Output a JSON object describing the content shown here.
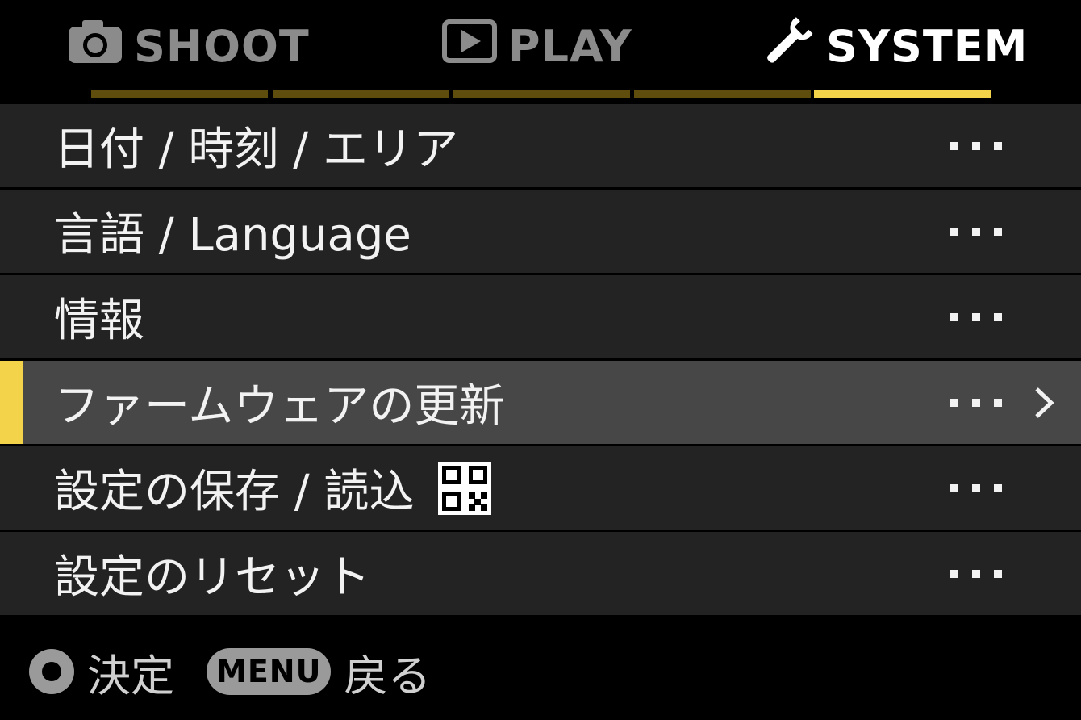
{
  "colors": {
    "accent": "#f2d34a",
    "inactive_segment": "#5e4d0c",
    "row_bg": "#232323",
    "row_selected_bg": "#474747"
  },
  "tabs": [
    {
      "label": "SHOOT",
      "icon": "camera-icon",
      "active": false
    },
    {
      "label": "PLAY",
      "icon": "playback-icon",
      "active": false
    },
    {
      "label": "SYSTEM",
      "icon": "wrench-icon",
      "active": true
    }
  ],
  "page_indicator": {
    "total_segments": 5,
    "active_segment": 5
  },
  "menu": {
    "items": [
      {
        "label": "日付 / 時刻 / エリア",
        "value": "･･･"
      },
      {
        "label": "言語 / Language",
        "value": "･･･"
      },
      {
        "label": "情報",
        "value": "･･･"
      },
      {
        "label": "ファームウェアの更新",
        "value": "･･･",
        "selected": true
      },
      {
        "label": "設定の保存 / 読込",
        "value": "･･･",
        "icon": "qr-code-icon"
      },
      {
        "label": "設定のリセット",
        "value": "･･･"
      }
    ]
  },
  "hints": {
    "ok_label": "決定",
    "ok_icon": "ok-button-icon",
    "menu_button": "MENU",
    "back_label": "戻る"
  }
}
